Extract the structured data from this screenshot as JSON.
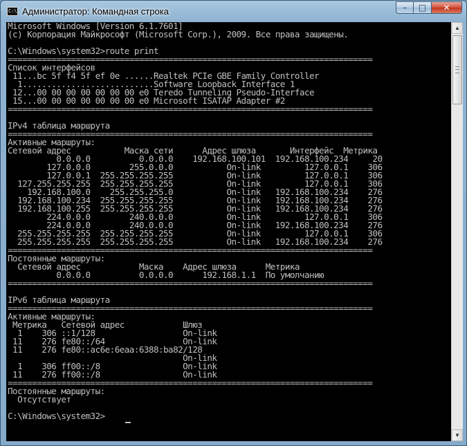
{
  "window": {
    "title": "Администратор: Командная строка",
    "icon_label": "C:\\",
    "buttons": {
      "minimize": "–",
      "maximize": "□",
      "close": "✕"
    }
  },
  "console": {
    "lines": [
      "Microsoft Windows [Version 6.1.7601]",
      "(c) Корпорация Майкрософт (Microsoft Corp.), 2009. Все права защищены.",
      "",
      "C:\\Windows\\system32>route print",
      "===========================================================================",
      "Список интерфейсов",
      " 11...bc 5f f4 5f ef 0e ......Realtek PCIe GBE Family Controller",
      "  1...........................Software Loopback Interface 1",
      " 12...00 00 00 00 00 00 00 e0 Teredo Tunneling Pseudo-Interface",
      " 15...00 00 00 00 00 00 00 e0 Microsoft ISATAP Adapter #2",
      "===========================================================================",
      "",
      "IPv4 таблица маршрута",
      "===========================================================================",
      "Активные маршруты:",
      "Сетевой адрес           Маска сети      Адрес шлюза       Интерфейс  Метрика",
      "          0.0.0.0          0.0.0.0    192.168.100.101  192.168.100.234     20",
      "        127.0.0.0        255.0.0.0           On-link         127.0.0.1    306",
      "        127.0.0.1  255.255.255.255           On-link         127.0.0.1    306",
      "  127.255.255.255  255.255.255.255           On-link         127.0.0.1    306",
      "    192.168.100.0    255.255.255.0           On-link   192.168.100.234    276",
      "  192.168.100.234  255.255.255.255           On-link   192.168.100.234    276",
      "  192.168.100.255  255.255.255.255           On-link   192.168.100.234    276",
      "        224.0.0.0        240.0.0.0           On-link         127.0.0.1    306",
      "        224.0.0.0        240.0.0.0           On-link   192.168.100.234    276",
      "  255.255.255.255  255.255.255.255           On-link         127.0.0.1    306",
      "  255.255.255.255  255.255.255.255           On-link   192.168.100.234    276",
      "===========================================================================",
      "Постоянные маршруты:",
      "  Сетевой адрес            Маска    Адрес шлюза      Метрика",
      "          0.0.0.0          0.0.0.0      192.168.1.1  По умолчанию",
      "===========================================================================",
      "",
      "IPv6 таблица маршрута",
      "===========================================================================",
      "Активные маршруты:",
      " Метрика   Сетевой адрес            Шлюз",
      "  1    306 ::1/128                  On-link",
      " 11    276 fe80::/64                On-link",
      " 11    276 fe80::ac6e:6eaa:6388:ba82/128",
      "                                    On-link",
      "  1    306 ff00::/8                 On-link",
      " 11    276 ff00::/8                 On-link",
      "===========================================================================",
      "Постоянные маршруты:",
      "  Отсутствует",
      "",
      "C:\\Windows\\system32>"
    ]
  }
}
